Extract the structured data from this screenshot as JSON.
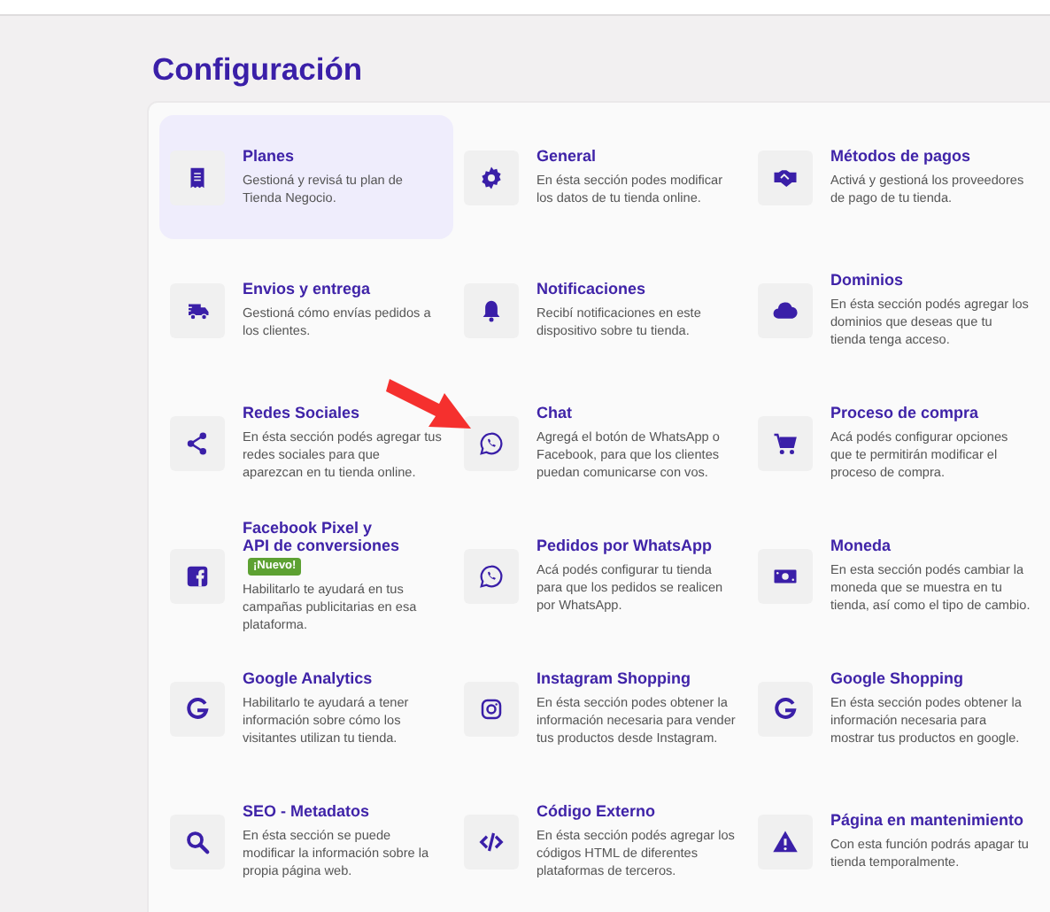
{
  "title": "Configuración",
  "items": [
    {
      "title": "Planes",
      "description": "Gestioná y revisá tu plan de Tienda Negocio.",
      "selected": true
    },
    {
      "title": "General",
      "description": "En ésta sección podes modificar los datos de tu tienda online.",
      "selected": false
    },
    {
      "title": "Métodos de pagos",
      "description": "Activá y gestioná los proveedores de pago de tu tienda.",
      "selected": false
    },
    {
      "title": "Envios y entrega",
      "description": "Gestioná cómo envías pedidos a los clientes.",
      "selected": false
    },
    {
      "title": "Notificaciones",
      "description": "Recibí notificaciones en este dispositivo sobre tu tienda.",
      "selected": false
    },
    {
      "title": "Dominios",
      "description": "En ésta sección podés agregar los dominios que deseas que tu tienda tenga acceso.",
      "selected": false
    },
    {
      "title": "Redes Sociales",
      "description": "En ésta sección podés agregar tus redes sociales para que aparezcan en tu tienda online.",
      "selected": false
    },
    {
      "title": "Chat",
      "description": "Agregá el botón de WhatsApp o Facebook, para que los clientes puedan comunicarse con vos.",
      "selected": false
    },
    {
      "title": "Proceso de compra",
      "description": "Acá podés configurar opciones que te permitirán modificar el proceso de compra.",
      "selected": false
    },
    {
      "title": "Facebook Pixel y\nAPI de conversiones",
      "badge": "¡Nuevo!",
      "description": "Habilitarlo te ayudará en tus campañas publicitarias en esa plataforma.",
      "selected": false
    },
    {
      "title": "Pedidos por WhatsApp",
      "description": "Acá podés configurar tu tienda para que los pedidos se realicen por WhatsApp.",
      "selected": false
    },
    {
      "title": "Moneda",
      "description": "En esta sección podés cambiar la moneda que se muestra en tu tienda, así como el tipo de cambio.",
      "selected": false
    },
    {
      "title": "Google Analytics",
      "description": "Habilitarlo te ayudará a tener información sobre cómo los visitantes utilizan tu tienda.",
      "selected": false
    },
    {
      "title": "Instagram Shopping",
      "description": "En ésta sección podes obtener la información necesaria para vender tus productos desde Instagram.",
      "selected": false
    },
    {
      "title": "Google Shopping",
      "description": "En ésta sección podes obtener la información necesaria para mostrar tus productos en google.",
      "selected": false
    },
    {
      "title": "SEO - Metadatos",
      "description": "En ésta sección se puede modificar la información sobre la propia página web.",
      "selected": false
    },
    {
      "title": "Código Externo",
      "description": "En ésta sección podés agregar los códigos HTML de diferentes plataformas de terceros.",
      "selected": false
    },
    {
      "title": "Página en mantenimiento",
      "description": "Con esta función podrás apagar tu tienda temporalmente.",
      "selected": false
    }
  ]
}
